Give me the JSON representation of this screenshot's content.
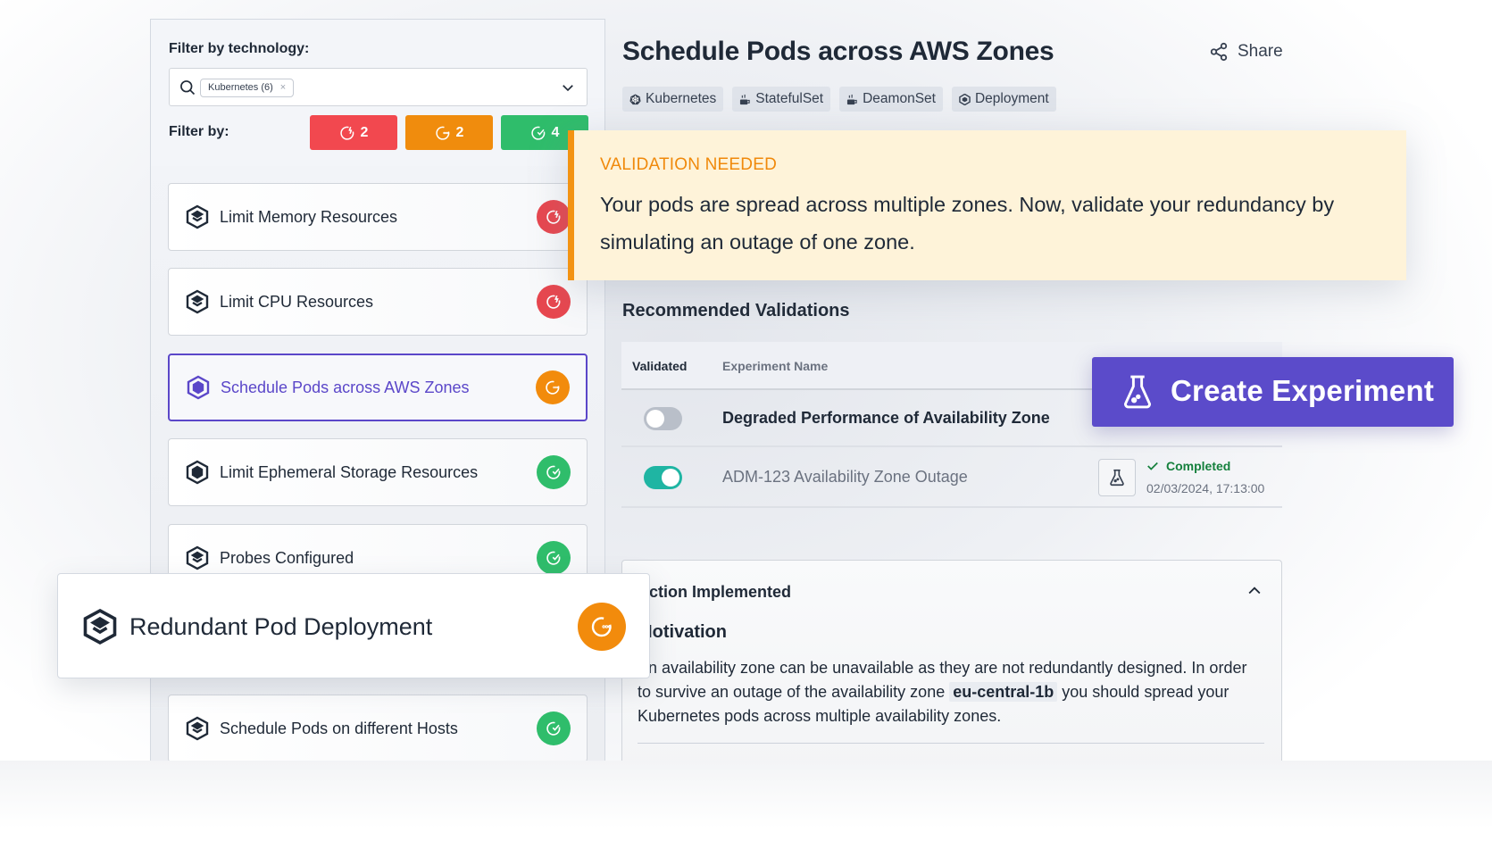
{
  "filters": {
    "technology_label": "Filter by technology:",
    "search_chip": "Kubernetes (6)",
    "chip_remove": "×",
    "filter_by_label": "Filter by:",
    "status_buttons": [
      {
        "status": "failed",
        "count": "2",
        "color": "#f2484f"
      },
      {
        "status": "pending",
        "count": "2",
        "color": "#f08c0d"
      },
      {
        "status": "passed",
        "count": "4",
        "color": "#2fbd6b"
      }
    ]
  },
  "checks": [
    {
      "label": "Limit Memory Resources",
      "status": "failed",
      "icon": "layers-hex-icon"
    },
    {
      "label": "Limit CPU Resources",
      "status": "failed",
      "icon": "layers-hex-icon"
    },
    {
      "label": "Schedule Pods across AWS Zones",
      "status": "pending",
      "icon": "filled-hex-icon",
      "active": true
    },
    {
      "label": "Limit Ephemeral Storage Resources",
      "status": "passed",
      "icon": "filled-hex-icon"
    },
    {
      "label": "Probes Configured",
      "status": "passed",
      "icon": "layers-hex-icon"
    },
    {
      "label": "Schedule Pods on different Hosts",
      "status": "passed",
      "icon": "layers-hex-icon"
    }
  ],
  "floating_check": {
    "label": "Redundant Pod Deployment",
    "status": "pending"
  },
  "detail": {
    "title": "Schedule Pods across AWS Zones",
    "share_label": "Share",
    "tags": [
      "Kubernetes",
      "StatefulSet",
      "DeamonSet",
      "Deployment"
    ],
    "alert": {
      "title": "VALIDATION NEEDED",
      "text": "Your pods are spread across multiple zones. Now, validate your redundancy by simulating an outage of one zone."
    },
    "recommended_title": "Recommended Validations",
    "table": {
      "headers": [
        "Validated",
        "Experiment Name"
      ],
      "rows": [
        {
          "validated": false,
          "name": "Degraded Performance of Availability Zone"
        },
        {
          "validated": true,
          "name": "ADM-123 Availability Zone Outage",
          "status": "Completed",
          "timestamp": "02/03/2024, 17:13:00"
        }
      ]
    },
    "create_button": "Create Experiment",
    "accordion": {
      "title": "Action Implemented",
      "motivation_title": "Motivation",
      "para_1": "An availability zone can be unavailable as they are not redundantly designed. In order to survive an outage of the availability zone ",
      "zone_code": "eu-central-1b",
      "para_2": " you should spread your Kubernetes pods across multiple availability zones."
    }
  },
  "colors": {
    "accent": "#5b4bca",
    "failed": "#e7474f",
    "pending": "#f28b0c",
    "passed": "#2fbd6b",
    "alert_bg": "#fef3d9",
    "toggle_on": "#1fb5a3"
  }
}
